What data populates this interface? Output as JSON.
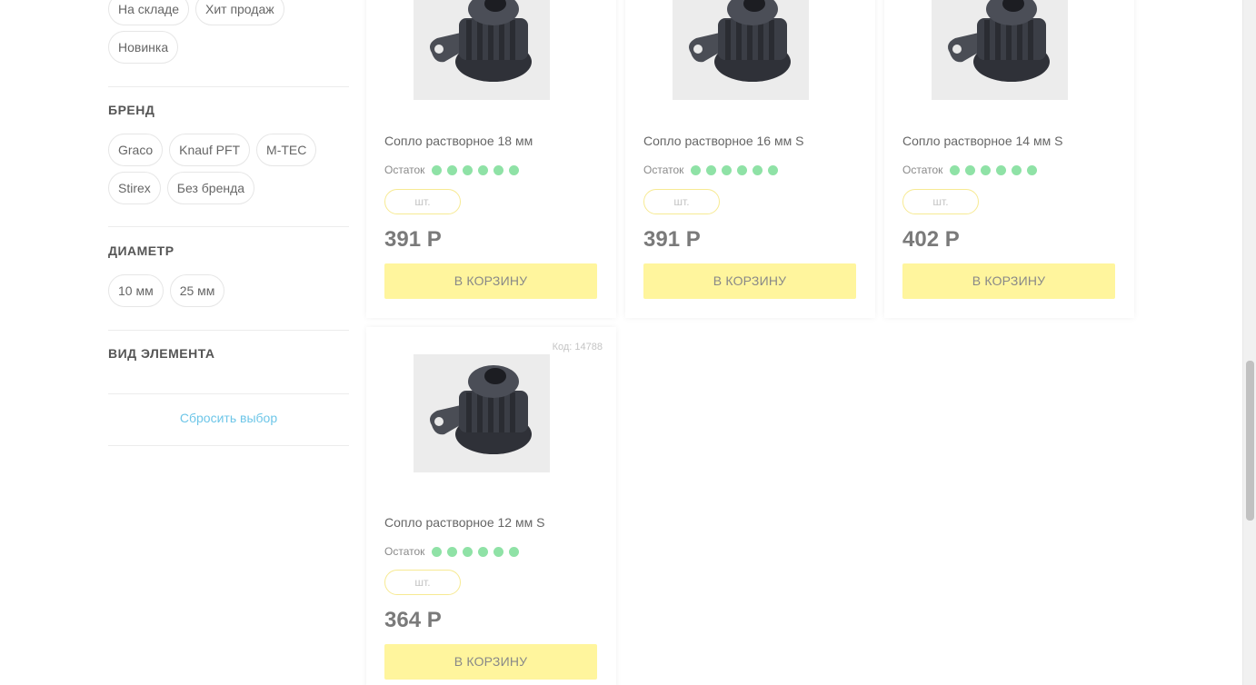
{
  "filters": {
    "availability_chips": [
      "На складе",
      "Хит продаж",
      "Новинка"
    ],
    "brand": {
      "title": "БРЕНД",
      "chips": [
        "Graco",
        "Knauf PFT",
        "M-TEC",
        "Stirex",
        "Без бренда"
      ]
    },
    "diameter": {
      "title": "ДИАМЕТР",
      "chips": [
        "10 мм",
        "25 мм"
      ]
    },
    "element_type": {
      "title": "ВИД ЭЛЕМЕНТА"
    },
    "reset_label": "Сбросить выбор"
  },
  "products": [
    {
      "title": "Сопло растворное 18 мм",
      "stock_label": "Остаток",
      "stock_dots": 6,
      "qty_unit": "шт.",
      "price": "391 Р",
      "button": "В КОРЗИНУ"
    },
    {
      "title": "Сопло растворное 16 мм S",
      "stock_label": "Остаток",
      "stock_dots": 6,
      "qty_unit": "шт.",
      "price": "391 Р",
      "button": "В КОРЗИНУ"
    },
    {
      "title": "Сопло растворное 14 мм S",
      "stock_label": "Остаток",
      "stock_dots": 6,
      "qty_unit": "шт.",
      "price": "402 Р",
      "button": "В КОРЗИНУ"
    },
    {
      "code": "Код: 14788",
      "title": "Сопло растворное 12 мм S",
      "stock_label": "Остаток",
      "stock_dots": 6,
      "qty_unit": "шт.",
      "price": "364 Р",
      "button": "В КОРЗИНУ"
    }
  ],
  "colors": {
    "button_bg": "#fff59d",
    "stock_dot": "#8fe2a6",
    "reset_link": "#6ec6e8"
  }
}
